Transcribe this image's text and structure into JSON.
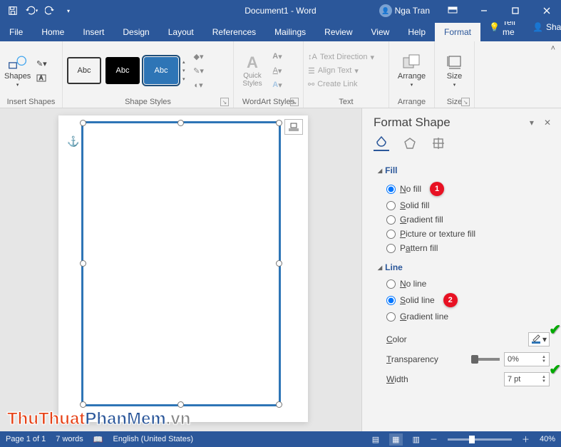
{
  "title_bar": {
    "doc_title": "Document1 - Word",
    "user_name": "Nga Tran"
  },
  "tabs": {
    "items": [
      "File",
      "Home",
      "Insert",
      "Design",
      "Layout",
      "References",
      "Mailings",
      "Review",
      "View",
      "Help",
      "Format"
    ],
    "active": "Format",
    "tell_me": "Tell me",
    "share": "Share"
  },
  "ribbon": {
    "insert_shapes": {
      "label": "Insert Shapes",
      "shapes_btn": "Shapes"
    },
    "shape_styles": {
      "label": "Shape Styles",
      "samples": [
        "Abc",
        "Abc",
        "Abc"
      ]
    },
    "wordart_styles": {
      "label": "WordArt Styles",
      "quick_styles": "Quick\nStyles"
    },
    "text": {
      "label": "Text",
      "direction": "Text Direction",
      "align": "Align Text",
      "link": "Create Link"
    },
    "arrange": {
      "label": "Arrange",
      "btn": "Arrange"
    },
    "size": {
      "label": "Size",
      "btn": "Size"
    }
  },
  "panel": {
    "title": "Format Shape",
    "fill": {
      "heading": "Fill",
      "options": {
        "no_fill": "No fill",
        "solid_fill": "Solid fill",
        "gradient_fill": "Gradient fill",
        "picture_fill": "Picture or texture fill",
        "pattern_fill": "Pattern fill"
      },
      "badge": "1"
    },
    "line": {
      "heading": "Line",
      "options": {
        "no_line": "No line",
        "solid_line": "Solid line",
        "gradient_line": "Gradient line"
      },
      "badge": "2",
      "color_label": "Color",
      "transparency_label": "Transparency",
      "transparency_value": "0%",
      "width_label": "Width",
      "width_value": "7 pt"
    }
  },
  "statusbar": {
    "page": "Page 1 of 1",
    "words": "7 words",
    "lang": "English (United States)",
    "zoom": "40%"
  },
  "watermark": {
    "a": "ThuThuat",
    "b": "PhanMem",
    "c": ".vn"
  }
}
